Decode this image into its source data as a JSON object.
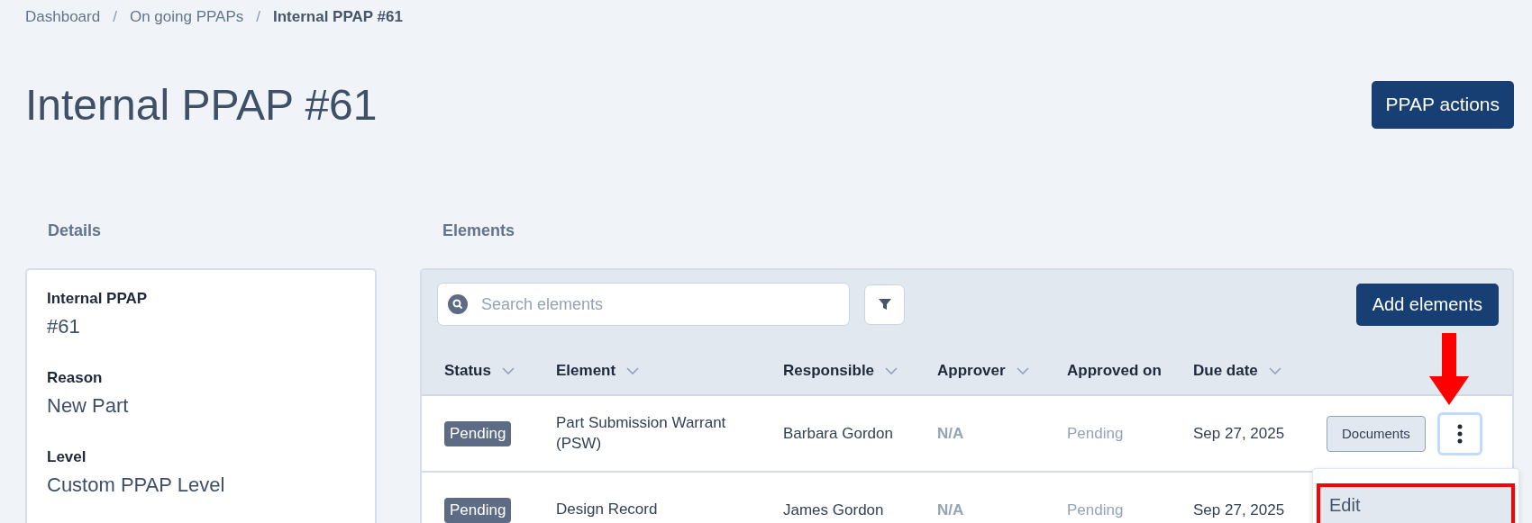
{
  "breadcrumb": [
    {
      "label": "Dashboard",
      "current": false
    },
    {
      "separator": "/",
      "label": "On going PPAPs",
      "current": false
    },
    {
      "separator": "/",
      "label": "Internal PPAP #61",
      "current": true
    }
  ],
  "title": "Internal PPAP #61",
  "actions_button": "PPAP actions",
  "details": {
    "heading": "Details",
    "fields": [
      {
        "label": "Internal PPAP",
        "value": "#61"
      },
      {
        "label": "Reason",
        "value": "New Part"
      },
      {
        "label": "Level",
        "value": "Custom PPAP Level"
      }
    ]
  },
  "elements": {
    "heading": "Elements",
    "search": {
      "placeholder": "Search elements"
    },
    "add_button": "Add elements",
    "columns": [
      {
        "label": "Status",
        "sortable": true
      },
      {
        "label": "Element",
        "sortable": true
      },
      {
        "label": "Responsible",
        "sortable": true
      },
      {
        "label": "Approver",
        "sortable": true
      },
      {
        "label": "Approved on",
        "sortable": false
      },
      {
        "label": "Due date",
        "sortable": true
      }
    ],
    "rows": [
      {
        "status": "Pending",
        "element": "Part Submission Warrant (PSW)",
        "responsible": "Barbara Gordon",
        "approver": "N/A",
        "approved_on": "Pending",
        "due_date": "Sep 27, 2025",
        "documents_button": "Documents",
        "menu_open": true
      },
      {
        "status": "Pending",
        "element": "Design Record",
        "responsible": "James Gordon",
        "approver": "N/A",
        "approved_on": "Pending",
        "due_date": "Sep 27, 2025",
        "menu_open": false
      }
    ],
    "row_menu": {
      "items": [
        {
          "label": "Edit",
          "highlighted": true
        }
      ]
    }
  }
}
